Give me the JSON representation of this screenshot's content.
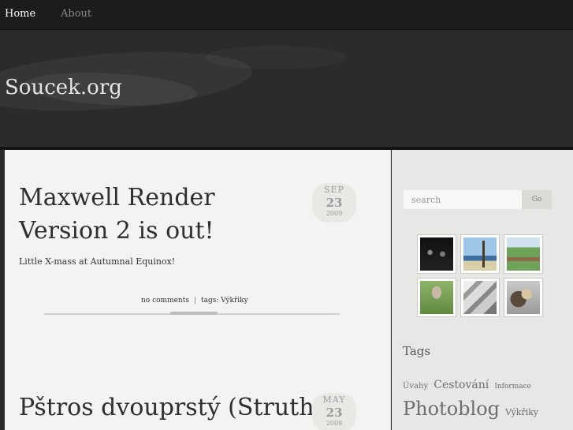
{
  "nav": {
    "home": "Home",
    "about": "About"
  },
  "site": {
    "title": "Soucek.org"
  },
  "posts": [
    {
      "title": "Maxwell Render Version 2 is out!",
      "excerpt": "Little X-mass at Autumnal Equinox!",
      "comments": "no comments",
      "tags_label": "tags:",
      "tag": "Výkřiky",
      "date": {
        "month": "SEP",
        "day": "23",
        "year": "2009"
      }
    },
    {
      "title": "Pštros dvouprstý (Struthio",
      "date": {
        "month": "MAY",
        "day": "23",
        "year": "2009"
      }
    }
  ],
  "sidebar": {
    "search_placeholder": "search",
    "go_label": "Go",
    "tags_heading": "Tags",
    "tags": [
      "Úvahy",
      "Cestování",
      "Informace",
      "Photoblog",
      "Výkřiky"
    ],
    "photos": [
      "concert-photo",
      "palm-beach-photo",
      "fence-field-photo",
      "ostrich-photo",
      "rock-photo",
      "eagle-photo"
    ]
  },
  "colors": {
    "background": "#2a2a2a",
    "content": "#f3f3f1",
    "sidebar": "#e7e7e5",
    "text": "#2e2e2e"
  }
}
